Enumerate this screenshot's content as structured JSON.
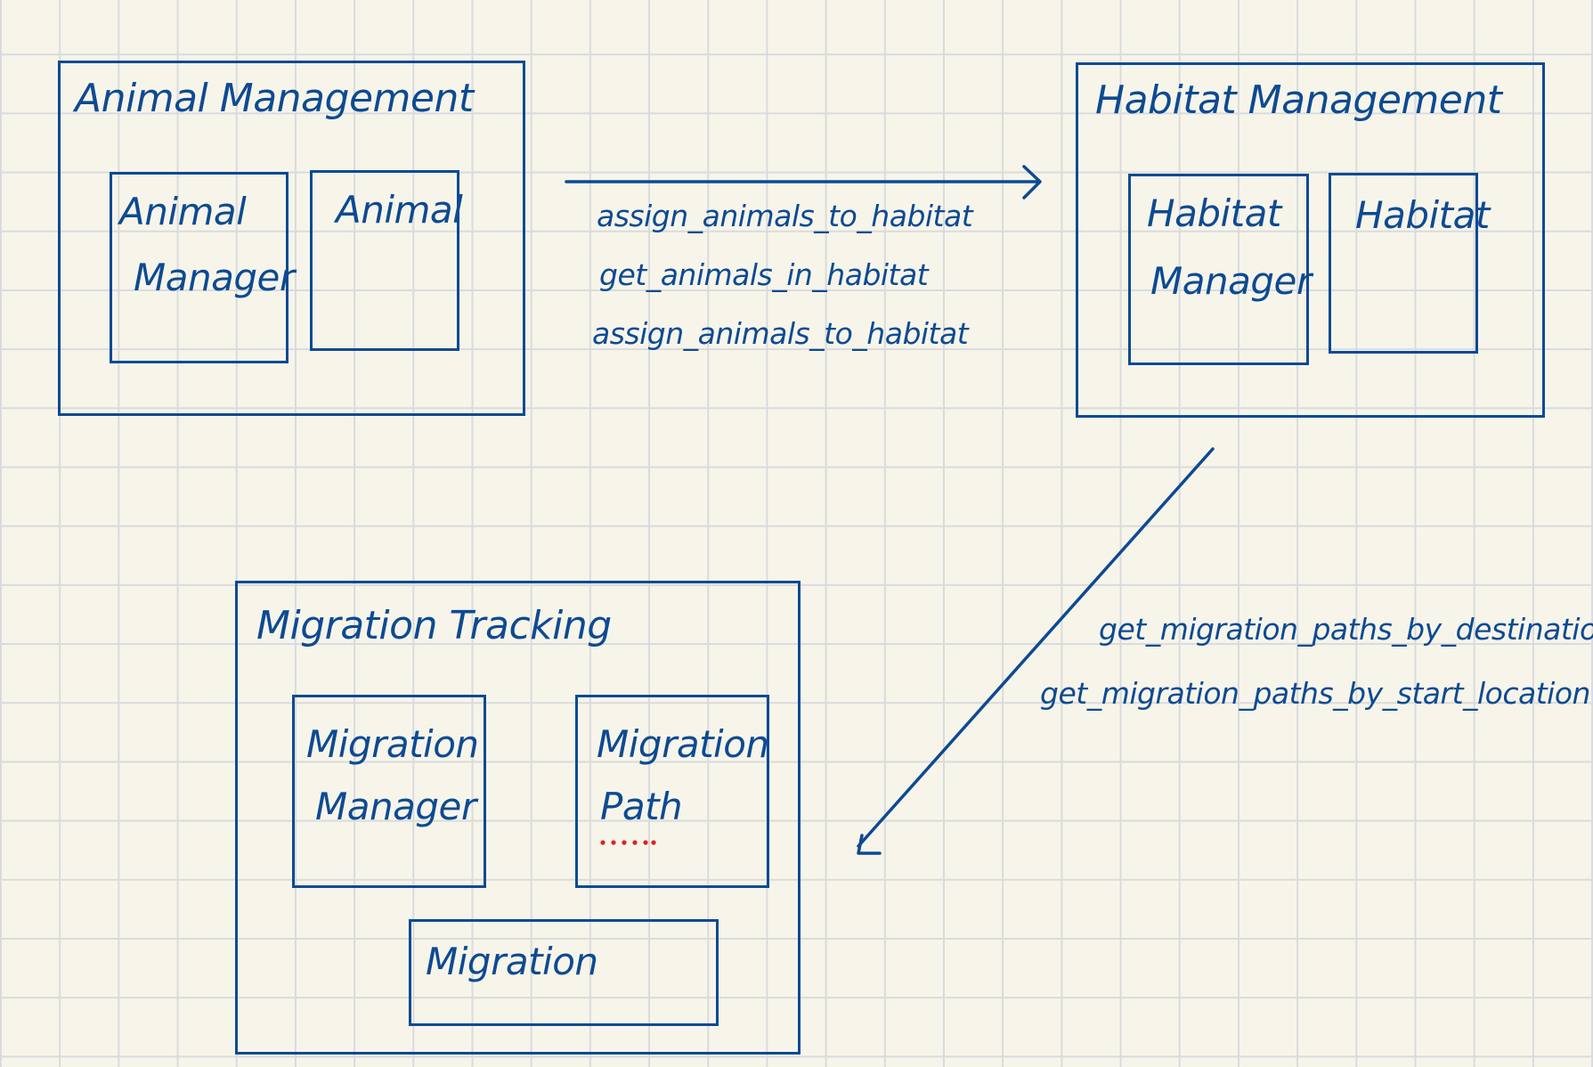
{
  "colors": {
    "ink": "#0d4a92",
    "accent_dots": "#e02020",
    "paper": "#f7f5ea",
    "grid": "#d9dbdc"
  },
  "animal_management": {
    "title": "Animal Management",
    "animal_manager_line1": "Animal",
    "animal_manager_line2": "Manager",
    "animal": "Animal"
  },
  "habitat_management": {
    "title": "Habitat Management",
    "habitat_manager_line1": "Habitat",
    "habitat_manager_line2": "Manager",
    "habitat": "Habitat"
  },
  "migration_tracking": {
    "title": "Migration Tracking",
    "migration_manager_line1": "Migration",
    "migration_manager_line2": "Manager",
    "migration_path_line1": "Migration",
    "migration_path_line2": "Path",
    "migration": "Migration"
  },
  "arrow_animal_to_habitat": {
    "methods": [
      "assign_animals_to_habitat",
      "get_animals_in_habitat",
      "assign_animals_to_habitat"
    ]
  },
  "arrow_habitat_to_migration": {
    "methods": [
      "get_migration_paths_by_destination",
      "get_migration_paths_by_start_location"
    ]
  }
}
